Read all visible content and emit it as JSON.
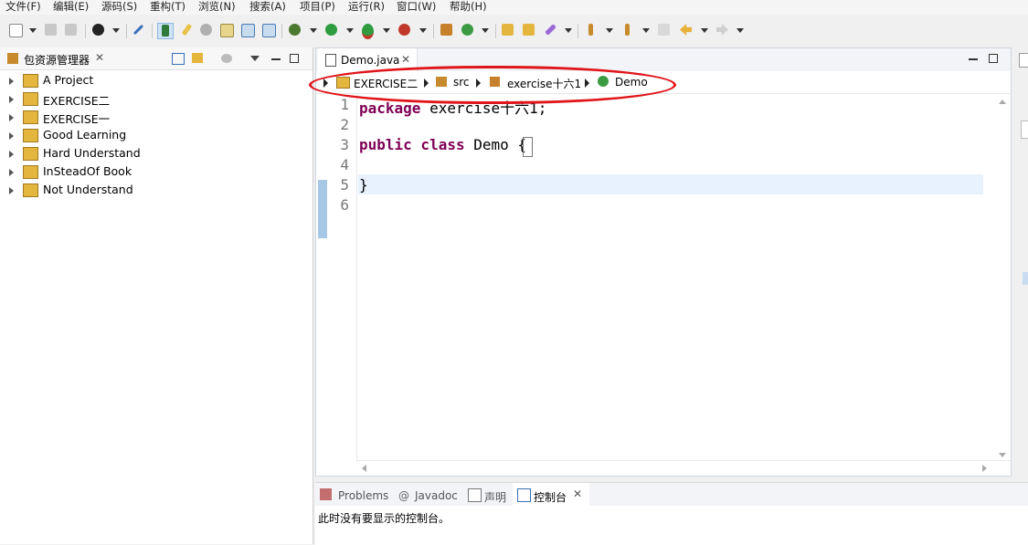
{
  "menu": [
    "文件(F)",
    "编辑(E)",
    "源码(S)",
    "重构(T)",
    "浏览(N)",
    "搜索(A)",
    "项目(P)",
    "运行(R)",
    "窗口(W)",
    "帮助(H)"
  ],
  "package_explorer": {
    "title": "包资源管理器",
    "projects": [
      "A Project",
      "EXERCISE二",
      "EXERCISE一",
      "Good Learning",
      "Hard Understand",
      "InSteadOf Book",
      "Not Understand"
    ]
  },
  "editor": {
    "tab": "Demo.java",
    "breadcrumb": [
      "EXERCISE二",
      "src",
      "exercise十六1",
      "Demo"
    ],
    "lines": [
      {
        "n": "1",
        "kw": "package",
        "rest": " exercise十六1;"
      },
      {
        "n": "2",
        "kw": "",
        "rest": ""
      },
      {
        "n": "3",
        "kw": "public class",
        "rest": " Demo {"
      },
      {
        "n": "4",
        "kw": "",
        "rest": ""
      },
      {
        "n": "5",
        "kw": "",
        "rest": "}"
      },
      {
        "n": "6",
        "kw": "",
        "rest": ""
      }
    ]
  },
  "bottom": {
    "tabs": [
      "Problems",
      "Javadoc",
      "声明",
      "控制台"
    ],
    "message": "此时没有要显示的控制台。"
  }
}
